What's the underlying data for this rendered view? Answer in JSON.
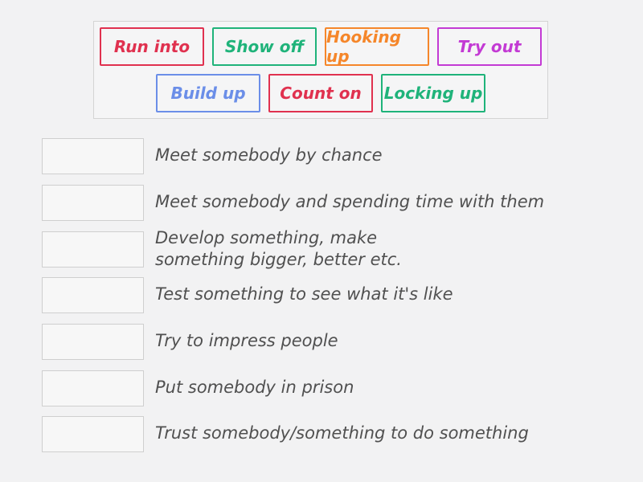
{
  "tiles": [
    {
      "label": "Run into",
      "color": "#e0314f"
    },
    {
      "label": "Show off",
      "color": "#1fb37a"
    },
    {
      "label": "Hooking up",
      "color": "#f5862a"
    },
    {
      "label": "Try out",
      "color": "#c33ad4"
    },
    {
      "label": "Build up",
      "color": "#6b8ee8"
    },
    {
      "label": "Count on",
      "color": "#e0314f"
    },
    {
      "label": "Locking up",
      "color": "#1fb37a"
    }
  ],
  "definitions": [
    {
      "line1": "Meet somebody by chance",
      "line2": ""
    },
    {
      "line1": "Meet somebody and spending time with them",
      "line2": ""
    },
    {
      "line1": "Develop something, make",
      "line2": "something bigger, better etc."
    },
    {
      "line1": "Test something to see what it's like",
      "line2": ""
    },
    {
      "line1": "Try to impress people",
      "line2": ""
    },
    {
      "line1": "Put somebody in prison",
      "line2": ""
    },
    {
      "line1": "Trust somebody/something to do something",
      "line2": ""
    }
  ]
}
